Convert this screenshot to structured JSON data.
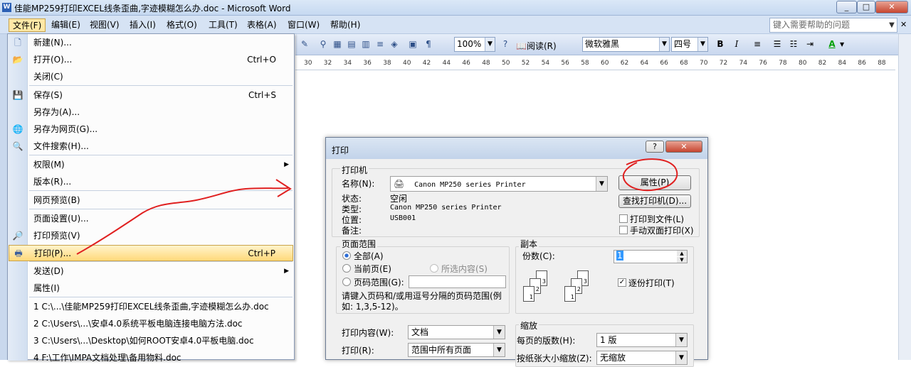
{
  "window": {
    "title": "佳能MP259打印EXCEL线条歪曲,字迹模糊怎么办.doc - Microsoft Word",
    "icon": "word-icon",
    "controls": [
      "_",
      "□",
      "✕"
    ]
  },
  "menubar": {
    "items": [
      "文件(F)",
      "编辑(E)",
      "视图(V)",
      "插入(I)",
      "格式(O)",
      "工具(T)",
      "表格(A)",
      "窗口(W)",
      "帮助(H)"
    ],
    "help_placeholder": "键入需要帮助的问题"
  },
  "toolbar": {
    "zoom": "100%",
    "read_label": "阅读(R)",
    "font": "微软雅黑",
    "font_size": "四号",
    "bold": "B",
    "italic": "I",
    "font_color": "A",
    "font_color_hex": "#00a000"
  },
  "ruler": {
    "ticks": [
      "30",
      "32",
      "34",
      "36",
      "38",
      "40",
      "42",
      "44",
      "46",
      "48",
      "50",
      "52",
      "54",
      "56",
      "58",
      "60",
      "62",
      "64",
      "66",
      "68",
      "70",
      "72",
      "74",
      "76",
      "78",
      "80",
      "82",
      "84",
      "86",
      "88"
    ]
  },
  "file_menu": {
    "items": [
      {
        "label": "新建(N)...",
        "shortcut": "",
        "icon": "new-doc-icon"
      },
      {
        "label": "打开(O)...",
        "shortcut": "Ctrl+O",
        "icon": "open-folder-icon"
      },
      {
        "label": "关闭(C)",
        "shortcut": "",
        "icon": ""
      },
      {
        "label": "保存(S)",
        "shortcut": "Ctrl+S",
        "icon": "save-icon"
      },
      {
        "label": "另存为(A)...",
        "shortcut": "",
        "icon": ""
      },
      {
        "label": "另存为网页(G)...",
        "shortcut": "",
        "icon": "web-page-icon"
      },
      {
        "label": "文件搜索(H)...",
        "shortcut": "",
        "icon": "file-search-icon"
      },
      {
        "label": "权限(M)",
        "shortcut": "",
        "icon": ""
      },
      {
        "label": "版本(R)...",
        "shortcut": "",
        "icon": ""
      },
      {
        "label": "网页预览(B)",
        "shortcut": "",
        "icon": ""
      },
      {
        "label": "页面设置(U)...",
        "shortcut": "",
        "icon": ""
      },
      {
        "label": "打印预览(V)",
        "shortcut": "",
        "icon": "print-preview-icon"
      },
      {
        "label": "打印(P)...",
        "shortcut": "Ctrl+P",
        "icon": "printer-icon"
      },
      {
        "label": "发送(D)",
        "shortcut": "",
        "icon": ""
      },
      {
        "label": "属性(I)",
        "shortcut": "",
        "icon": ""
      },
      {
        "label": "1 C:\\...\\佳能MP259打印EXCEL线条歪曲,字迹模糊怎么办.doc",
        "shortcut": "",
        "icon": ""
      },
      {
        "label": "2 C:\\Users\\...\\安卓4.0系统平板电脑连接电脑方法.doc",
        "shortcut": "",
        "icon": ""
      },
      {
        "label": "3 C:\\Users\\...\\Desktop\\如何ROOT安卓4.0平板电脑.doc",
        "shortcut": "",
        "icon": ""
      },
      {
        "label": "4 F:\\工作\\IMPA文档处理\\备用物料.doc",
        "shortcut": "",
        "icon": ""
      }
    ]
  },
  "print_dialog": {
    "title": "打印",
    "help": "?",
    "close": "✕",
    "printer_group": "打印机",
    "name_label": "名称(N):",
    "printer_name": "Canon MP250 series Printer",
    "properties": "属性(P)",
    "find_printer": "查找打印机(D)...",
    "status_label": "状态:",
    "status_value": "空闲",
    "type_label": "类型:",
    "type_value": "Canon MP250 series Printer",
    "location_label": "位置:",
    "location_value": "USB001",
    "comment_label": "备注:",
    "comment_value": "",
    "print_to_file": "打印到文件(L)",
    "manual_duplex": "手动双面打印(X)",
    "page_range_group": "页面范围",
    "all": "全部(A)",
    "current_page": "当前页(E)",
    "selection": "所选内容(S)",
    "pages": "页码范围(G):",
    "range_hint": "请键入页码和/或用逗号分隔的页码范围(例如: 1,3,5-12)。",
    "copies_group": "副本",
    "copies_label": "份数(C):",
    "copies_value": "1",
    "collate": "逐份打印(T)",
    "collate_checked": true,
    "print_what_label": "打印内容(W):",
    "print_what_value": "文档",
    "print_label": "打印(R):",
    "print_value": "范围中所有页面",
    "zoom_group": "缩放",
    "pages_per_sheet_label": "每页的版数(H):",
    "pages_per_sheet_value": "1 版",
    "scale_label": "按纸张大小缩放(Z):",
    "scale_value": "无缩放",
    "collate_pages": [
      "1",
      "2",
      "3"
    ]
  }
}
